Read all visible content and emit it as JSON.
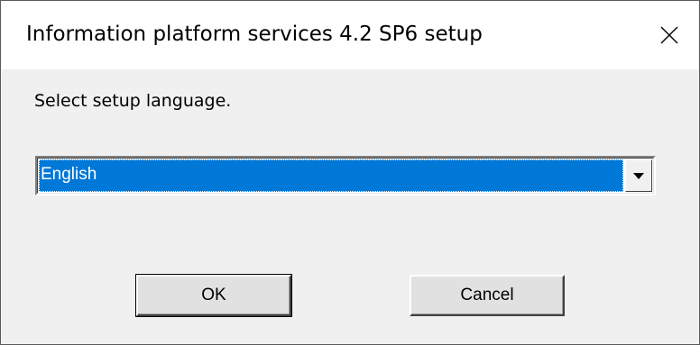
{
  "window": {
    "title": "Information platform services 4.2 SP6 setup"
  },
  "dialog": {
    "prompt": "Select setup language.",
    "language_select": {
      "selected": "English"
    },
    "ok_label": "OK",
    "cancel_label": "Cancel"
  },
  "colors": {
    "selection": "#0078d7",
    "background": "#f0f0f0",
    "titlebar": "#ffffff"
  }
}
